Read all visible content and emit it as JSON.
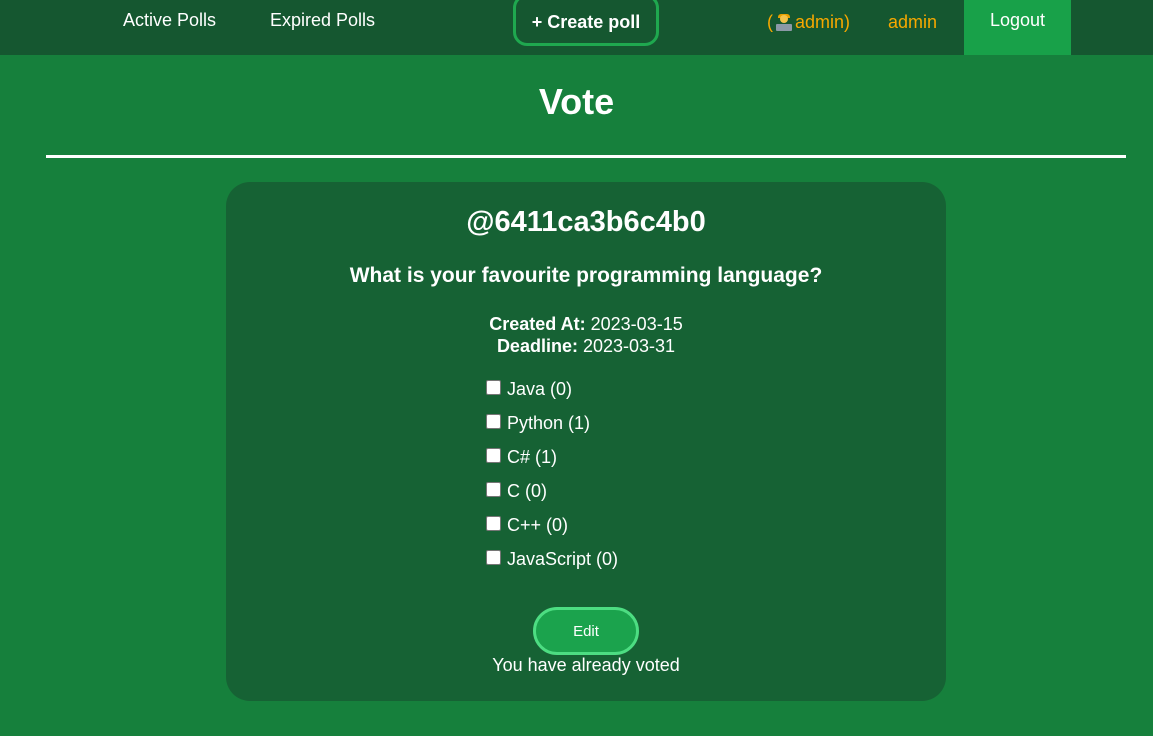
{
  "nav": {
    "active_polls": "Active Polls",
    "expired_polls": "Expired Polls",
    "create_poll": "+ Create poll",
    "role_open": "(",
    "role_name": "admin)",
    "username": "admin",
    "logout": "Logout"
  },
  "page": {
    "title": "Vote"
  },
  "poll": {
    "id": "@6411ca3b6c4b0",
    "question": "What is your favourite programming language?",
    "created_label": "Created At:",
    "created_value": "2023-03-15",
    "deadline_label": "Deadline:",
    "deadline_value": "2023-03-31",
    "options": [
      {
        "label": "Java (0)",
        "checked": false
      },
      {
        "label": "Python (1)",
        "checked": false
      },
      {
        "label": "C# (1)",
        "checked": false
      },
      {
        "label": "C (0)",
        "checked": false
      },
      {
        "label": "C++ (0)",
        "checked": false
      },
      {
        "label": "JavaScript (0)",
        "checked": false
      }
    ],
    "edit_label": "Edit",
    "voted_message": "You have already voted"
  },
  "icons": {
    "user_role": "technologist-icon"
  },
  "colors": {
    "background": "#16803c",
    "navbar": "#155730",
    "card": "#166234",
    "accent": "#18a149",
    "highlight_text": "#f6a800"
  }
}
